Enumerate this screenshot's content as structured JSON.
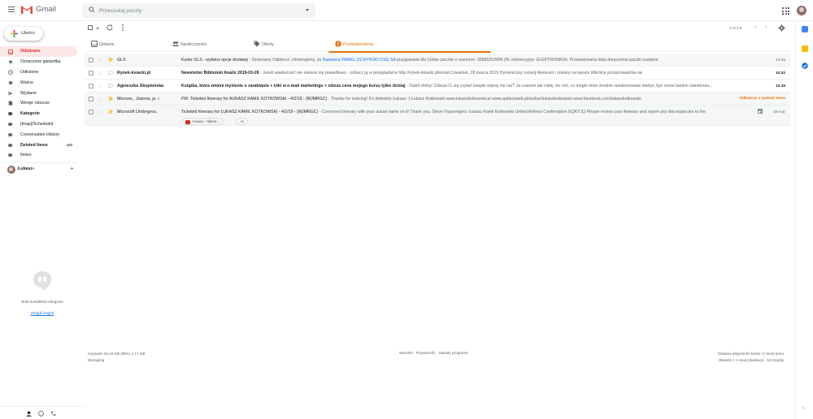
{
  "app": {
    "name": "Gmail"
  },
  "search": {
    "placeholder": "Przeszukaj poczty"
  },
  "compose": {
    "label": "Utwórz"
  },
  "sidebar": {
    "items": [
      {
        "label": "Odebrane",
        "icon": "inbox-icon",
        "active": true
      },
      {
        "label": "Oznaczone gwiazdką",
        "icon": "star-icon"
      },
      {
        "label": "Odłożone",
        "icon": "clock-icon"
      },
      {
        "label": "Ważne",
        "icon": "important-icon"
      },
      {
        "label": "Wysłane",
        "icon": "send-icon"
      },
      {
        "label": "Wersje robocze",
        "icon": "draft-icon"
      },
      {
        "label": "Kategorie",
        "icon": "label-icon",
        "bold": true
      },
      {
        "label": "[Imap]/Scheduled",
        "icon": "label-icon"
      },
      {
        "label": "Conversation History",
        "icon": "label-icon"
      },
      {
        "label": "Deleted Items",
        "icon": "label-icon",
        "bold": true,
        "count": "489"
      },
      {
        "label": "Notes",
        "icon": "label-icon"
      }
    ],
    "user": {
      "name": "Łukasz",
      "caret": "▾",
      "add": "+"
    }
  },
  "hangouts": {
    "empty_text": "Brak kontaktów Hangouts",
    "find_link": "Znajdź kogoś"
  },
  "toolbar": {
    "range": "1–5 z 5",
    "prev": "‹",
    "next": "›"
  },
  "tabs": [
    {
      "label": "Główne",
      "icon": "inbox-tab-icon"
    },
    {
      "label": "Społeczności",
      "icon": "people-icon"
    },
    {
      "label": "Oferty",
      "icon": "tag-icon"
    },
    {
      "label": "Powiadomienia",
      "icon": "info-icon",
      "active": true
    }
  ],
  "emails": [
    {
      "sender": "GLS",
      "count": "",
      "subject": "Kurier GLS - wybierz opcje dostawy",
      "snippet_pre": " - Szanowny Odbiorco, informujemy, że ",
      "snippet_hl": "Nadawca PAWEL OCHYNSKI CSG SA",
      "snippet_post": " przygotował dla Ciebie paczkę o numerze: 30685259496 (Nr referencyjny: ELEKTRONIKA). Przewidywana data doręczenia paczki zostanie",
      "date": "10:42",
      "unread": false
    },
    {
      "sender": "Rynek-ksiazki.pl",
      "count": "",
      "subject": "Newsletter Biblioteki Analiz 2019-03-28",
      "snippet_pre": " - Jeżeli wiadomość nie otwiera się prawidłowo - zobacz ją w przeglądarce http://rynek-ksiazki.pl/email Czwartek, 28 marca 2019 Dynamiczny rozwój Ateneum i zmiany na lepsze Wkrótce przeprowadzka na",
      "snippet_hl": "",
      "snippet_post": "",
      "date": "10:42",
      "unread": true
    },
    {
      "sender": "Agnieszka Skupieńska",
      "count": "",
      "subject": "Książka, która zmieni myślenie o zarabianiu + triki w e-mail marketingu + niższa cena mojego kursu tylko dzisiaj",
      "snippet_pre": " - Dzień dobry! Zdarza Ci się czytać książki więcej niż raz? Ja czasem tak robię, bo coś, co mogło mnie średnio zainteresować kiedyś, być może bardzo zainteresu...",
      "snippet_hl": "",
      "snippet_post": "",
      "date": "10:39",
      "unread": true
    },
    {
      "sender": "Microso., Joanna, ja",
      "count": "4",
      "subject": "FW: Ticketed Itinerary for AUKASZ KAMIL KOTKOWSKI - 4/2/19 - (MJMRGC)",
      "snippet_pre": " - Thanks for noticing! It's definitely Łukasz :) Łukasz Kotkowski www.lukaszkotkowski.pl www.spidersweb.pl/author/lukaszkotkowski www.facebook.com/lukaszkotkowski",
      "snippet_hl": "",
      "snippet_post": "",
      "date": "",
      "snoozed": "Odłożono 1 tydzień temu",
      "unread": false
    },
    {
      "sender": "Microsoft Undergrou.",
      "count": "",
      "subject": "Ticketed Itinerary for ŁUKASZ KAMIL KOTKOWSKI - 4/2/19 - (MJMRGC)",
      "snippet_pre": " - Corrected itinerary with your actual name on it! Thank you, Steve Passengers: Łukasz Kamil Kotkowski United Airlines Confirmation EQKYJQ Please review your itinerary and report any discrepancies to the",
      "snippet_hl": "",
      "snippet_post": "",
      "date": "28 mar",
      "unread": false,
      "attachment": "Invoice - Itinera...",
      "more_attachments": "+1"
    }
  ],
  "footer": {
    "storage": "Używasz 15,16 GB (95%) z 17 GB",
    "manage": "Zarządzaj",
    "links": "Warunki · Prywatność · Zasady programu",
    "activity": "Ostatnia aktywność konta: 0 minut temu",
    "details": "Otwarte z 1 innej lokalizacji · Szczegóły"
  },
  "colors": {
    "accent": "#d93025",
    "notifications": "#e8710a",
    "link": "#1a73e8"
  }
}
